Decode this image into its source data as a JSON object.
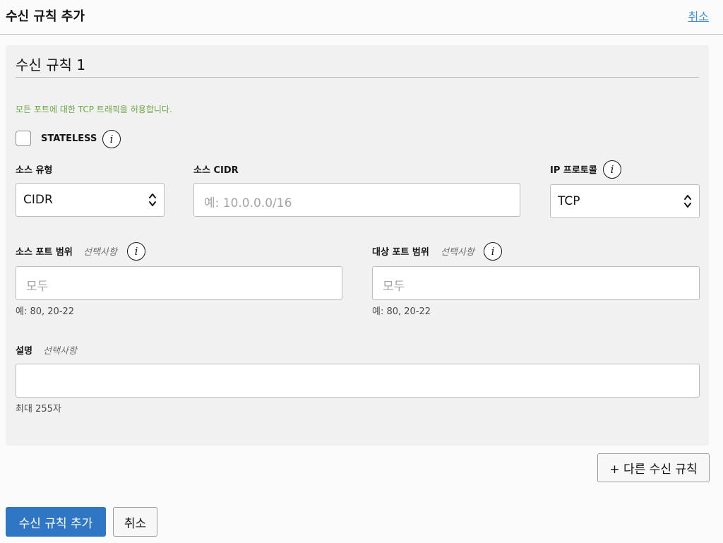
{
  "header": {
    "title": "수신 규칙 추가",
    "cancel_link": "취소"
  },
  "rule": {
    "title": "수신 규칙 1",
    "tcp_notice": "모든 포트에 대한 TCP 트래픽을 허용합니다.",
    "stateless_label": "STATELESS",
    "stateless_checked": false
  },
  "fields": {
    "source_type": {
      "label": "소스 유형",
      "value": "CIDR"
    },
    "source_cidr": {
      "label": "소스 CIDR",
      "value": "",
      "placeholder": "예: 10.0.0.0/16"
    },
    "ip_protocol": {
      "label": "IP 프로토콜",
      "value": "TCP"
    },
    "source_port_range": {
      "label": "소스 포트 범위",
      "optional": "선택사항",
      "value": "",
      "placeholder": "모두",
      "help": "예: 80, 20-22"
    },
    "dest_port_range": {
      "label": "대상 포트 범위",
      "optional": "선택사항",
      "value": "",
      "placeholder": "모두",
      "help": "예: 80, 20-22"
    },
    "description": {
      "label": "설명",
      "optional": "선택사항",
      "value": "",
      "help": "최대 255자"
    }
  },
  "buttons": {
    "add_another": "+ 다른 수신 규칙",
    "submit": "수신 규칙 추가",
    "cancel": "취소"
  },
  "icons": {
    "info": "info-icon",
    "select_arrows": "chevron-up-down-icon"
  },
  "colors": {
    "primary": "#2f77c4",
    "link": "#3d8fd6",
    "notice_green": "#6aa843"
  }
}
